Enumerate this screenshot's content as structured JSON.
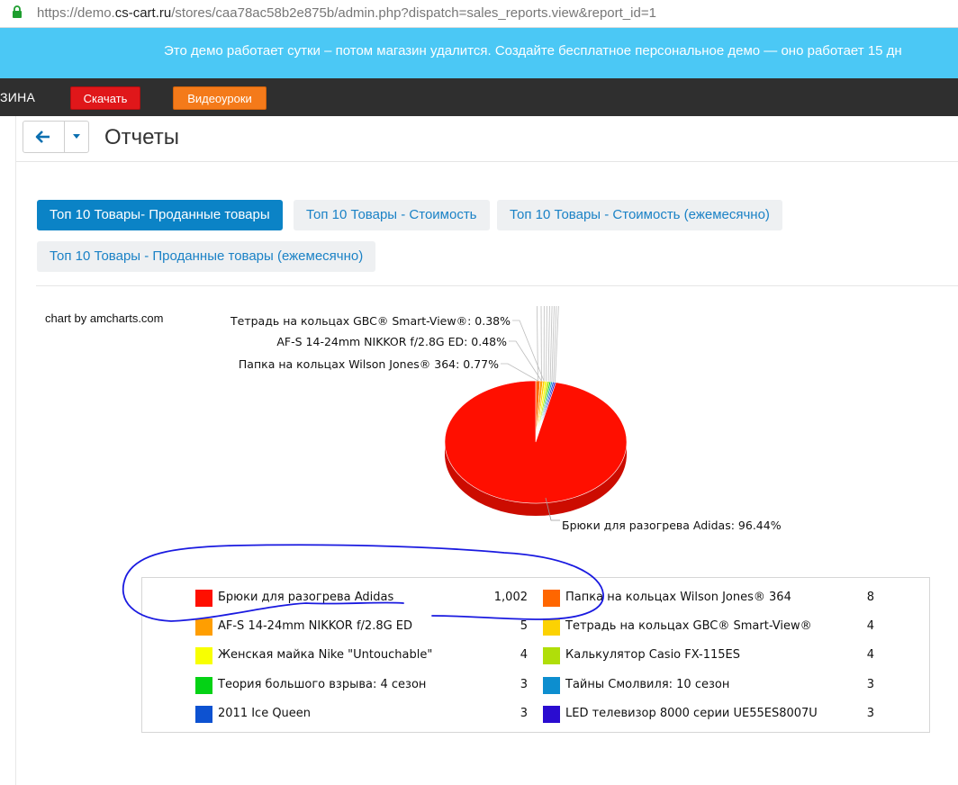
{
  "browser": {
    "url_prefix": "https://demo.",
    "url_host": "cs-cart.ru",
    "url_rest": "/stores/caa78ac58b2e875b/admin.php?dispatch=sales_reports.view&report_id=1"
  },
  "banner": {
    "text": "Это демо работает сутки – потом магазин удалится. Создайте бесплатное персональное демо — оно работает 15 дн"
  },
  "topbar": {
    "crumb": "ЗИНА",
    "download_label": "Скачать",
    "video_label": "Видеоуроки"
  },
  "page": {
    "title": "Отчеты"
  },
  "tabs": [
    {
      "label": "Топ 10 Товары- Проданные товары",
      "active": true
    },
    {
      "label": "Топ 10 Товары - Стоимость",
      "active": false
    },
    {
      "label": "Топ 10 Товары - Стоимость (ежемесячно)",
      "active": false
    },
    {
      "label": "Топ 10 Товары - Проданные товары (ежемесячно)",
      "active": false
    }
  ],
  "chart_credit": "chart by amcharts.com",
  "chart_data": {
    "type": "pie",
    "slice_labels": [
      "Тетрадь на кольцах GBC® Smart-View®: 0.38%",
      "AF-S 14-24mm NIKKOR f/2.8G ED: 0.48%",
      "Папка на кольцах Wilson Jones® 364: 0.77%",
      "Брюки для разогрева Adidas: 96.44%"
    ],
    "slices": [
      {
        "name": "Брюки для разогрева Adidas",
        "value": 1002,
        "color": "#ff0f00"
      },
      {
        "name": "Папка на кольцах Wilson Jones® 364",
        "value": 8,
        "color": "#ff6600"
      },
      {
        "name": "AF-S 14-24mm NIKKOR f/2.8G ED",
        "value": 5,
        "color": "#ff9e01"
      },
      {
        "name": "Тетрадь на кольцах GBC® Smart-View®",
        "value": 4,
        "color": "#fcd202"
      },
      {
        "name": "Женская майка Nike \"Untouchable\"",
        "value": 4,
        "color": "#f8ff01"
      },
      {
        "name": "Калькулятор Casio FX-115ES",
        "value": 4,
        "color": "#b0de09"
      },
      {
        "name": "Теория большого взрыва: 4 сезон",
        "value": 3,
        "color": "#04d215"
      },
      {
        "name": "Тайны Смолвиля: 10 сезон",
        "value": 3,
        "color": "#0d8ecf"
      },
      {
        "name": "2011 Ice Queen",
        "value": 3,
        "color": "#0d52d1"
      },
      {
        "name": "LED телевизор 8000 серии UE55ES8007U",
        "value": 3,
        "color": "#2a0cd0"
      }
    ]
  },
  "legend": {
    "items": [
      {
        "name": "Брюки для разогрева Adidas",
        "value": "1,002",
        "color": "#ff0f00"
      },
      {
        "name": "Папка на кольцах Wilson Jones® 364",
        "value": "8",
        "color": "#ff6600"
      },
      {
        "name": "AF-S 14-24mm NIKKOR f/2.8G ED",
        "value": "5",
        "color": "#ff9e01"
      },
      {
        "name": "Тетрадь на кольцах GBC® Smart-View®",
        "value": "4",
        "color": "#fcd202"
      },
      {
        "name": "Женская майка Nike \"Untouchable\"",
        "value": "4",
        "color": "#f8ff01"
      },
      {
        "name": "Калькулятор Casio FX-115ES",
        "value": "4",
        "color": "#b0de09"
      },
      {
        "name": "Теория большого взрыва: 4 сезон",
        "value": "3",
        "color": "#04d215"
      },
      {
        "name": "Тайны Смолвиля: 10 сезон",
        "value": "3",
        "color": "#0d8ecf"
      },
      {
        "name": "2011 Ice Queen",
        "value": "3",
        "color": "#0d52d1"
      },
      {
        "name": "LED телевизор 8000 серии UE55ES8007U",
        "value": "3",
        "color": "#2a0cd0"
      }
    ]
  }
}
